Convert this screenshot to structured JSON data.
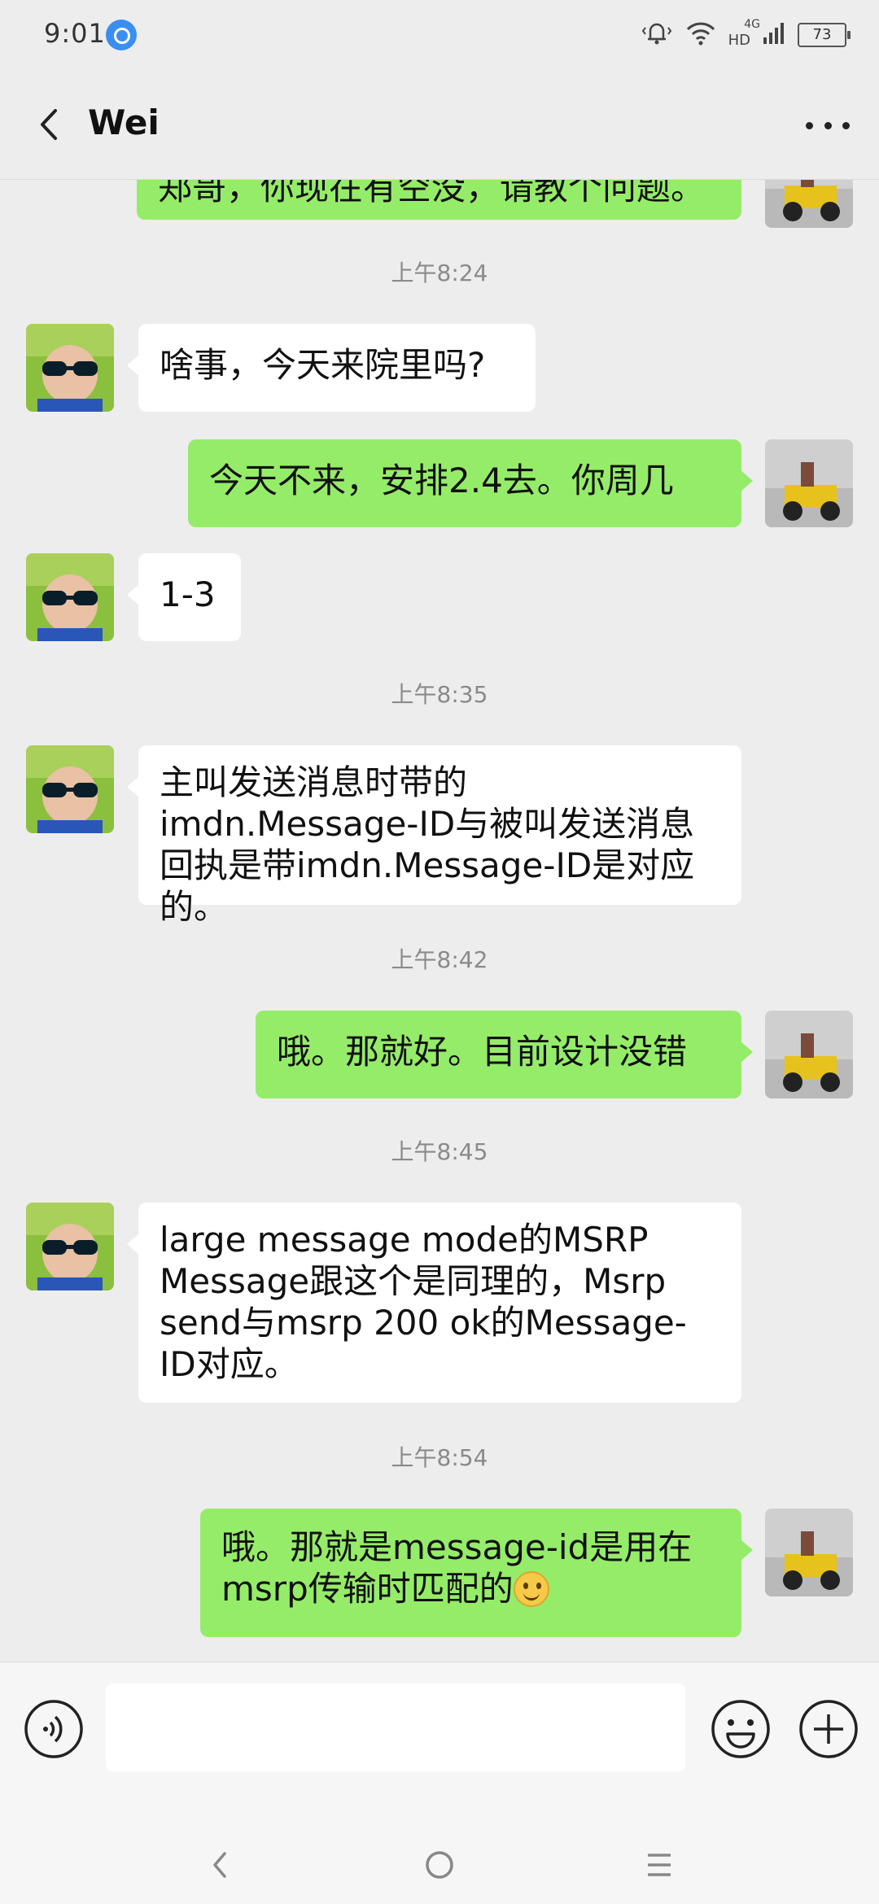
{
  "status_bar": {
    "time": "9:01",
    "network_4g": "4G",
    "network_hd": "HD",
    "battery": "73"
  },
  "header": {
    "back_icon": "chevron-left-icon",
    "title": "Wei",
    "more_icon": "more-dots-icon"
  },
  "messages": [
    {
      "type": "out",
      "text": "郑哥，你现在有空没，请教个问题。",
      "partial": true
    },
    {
      "type": "time",
      "text": "上午8:24"
    },
    {
      "type": "in",
      "text": "啥事，今天来院里吗?"
    },
    {
      "type": "out",
      "text": "今天不来，安排2.4去。你周几"
    },
    {
      "type": "in",
      "text": "1-3"
    },
    {
      "type": "time",
      "text": "上午8:35"
    },
    {
      "type": "in",
      "text": "主叫发送消息时带的imdn.Message-ID与被叫发送消息回执是带imdn.Message-ID是对应的。"
    },
    {
      "type": "time",
      "text": "上午8:42"
    },
    {
      "type": "out",
      "text": "哦。那就好。目前设计没错"
    },
    {
      "type": "time",
      "text": "上午8:45"
    },
    {
      "type": "in",
      "text": "large message mode的MSRP Message跟这个是同理的，Msrp send与msrp 200 ok的Message-ID对应。"
    },
    {
      "type": "time",
      "text": "上午8:54"
    },
    {
      "type": "out",
      "text": "哦。那就是message-id是用在msrp传输时匹配的",
      "emoji": "smile-emoji-icon"
    }
  ],
  "input_bar": {
    "voice_icon": "voice-icon",
    "text_value": "",
    "emoji_icon": "emoji-icon",
    "plus_icon": "plus-icon"
  },
  "nav_bar": {
    "back_icon": "nav-back-icon",
    "home_icon": "nav-home-icon",
    "menu_icon": "nav-menu-icon"
  },
  "colors": {
    "background": "#ededed",
    "bubble_out": "#95ec69",
    "bubble_in": "#ffffff",
    "timestamp": "#8a8a8a"
  }
}
